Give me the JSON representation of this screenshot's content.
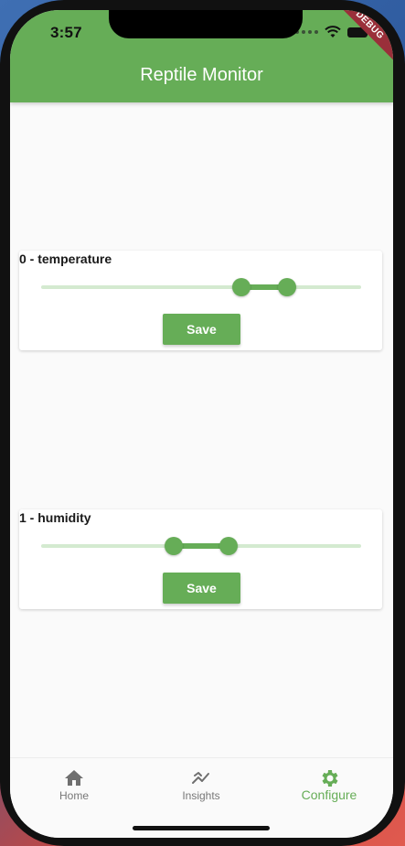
{
  "status_bar": {
    "time": "3:57"
  },
  "debug_banner": "DEBUG",
  "app_bar": {
    "title": "Reptile Monitor"
  },
  "cards": [
    {
      "title": "0 - temperature",
      "range": {
        "low": 0.62,
        "high": 0.77
      },
      "save_label": "Save"
    },
    {
      "title": "1 - humidity",
      "range": {
        "low": 0.41,
        "high": 0.58
      },
      "save_label": "Save"
    }
  ],
  "bottom_nav": {
    "items": [
      {
        "label": "Home",
        "icon": "home-icon"
      },
      {
        "label": "Insights",
        "icon": "insights-icon"
      },
      {
        "label": "Configure",
        "icon": "gear-icon"
      }
    ],
    "active": "Configure"
  },
  "colors": {
    "primary": "#66ad57",
    "track": "#d4ead0",
    "background": "#fafafa"
  }
}
